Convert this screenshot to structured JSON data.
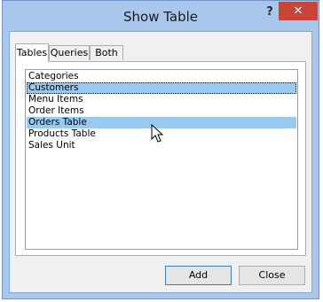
{
  "dialog": {
    "title": "Show Table",
    "help_glyph": "?",
    "close_glyph": "✕"
  },
  "tabs": [
    {
      "label": "Tables",
      "active": true
    },
    {
      "label": "Queries",
      "active": false
    },
    {
      "label": "Both",
      "active": false
    }
  ],
  "tables_list": {
    "items": [
      {
        "label": "Categories",
        "selected": false,
        "focused": false
      },
      {
        "label": "Customers",
        "selected": true,
        "focused": true
      },
      {
        "label": "Menu Items",
        "selected": false,
        "focused": false
      },
      {
        "label": "Order Items",
        "selected": false,
        "focused": false
      },
      {
        "label": "Orders Table",
        "selected": true,
        "focused": false
      },
      {
        "label": "Products Table",
        "selected": false,
        "focused": false
      },
      {
        "label": "Sales Unit",
        "selected": false,
        "focused": false
      }
    ]
  },
  "buttons": {
    "add_label": "Add",
    "close_label": "Close"
  },
  "colors": {
    "frame": "#a9c7ed",
    "close_button": "#c7463a",
    "selection": "#99c9ef"
  },
  "icons": {
    "cursor": "mouse-pointer-icon"
  }
}
